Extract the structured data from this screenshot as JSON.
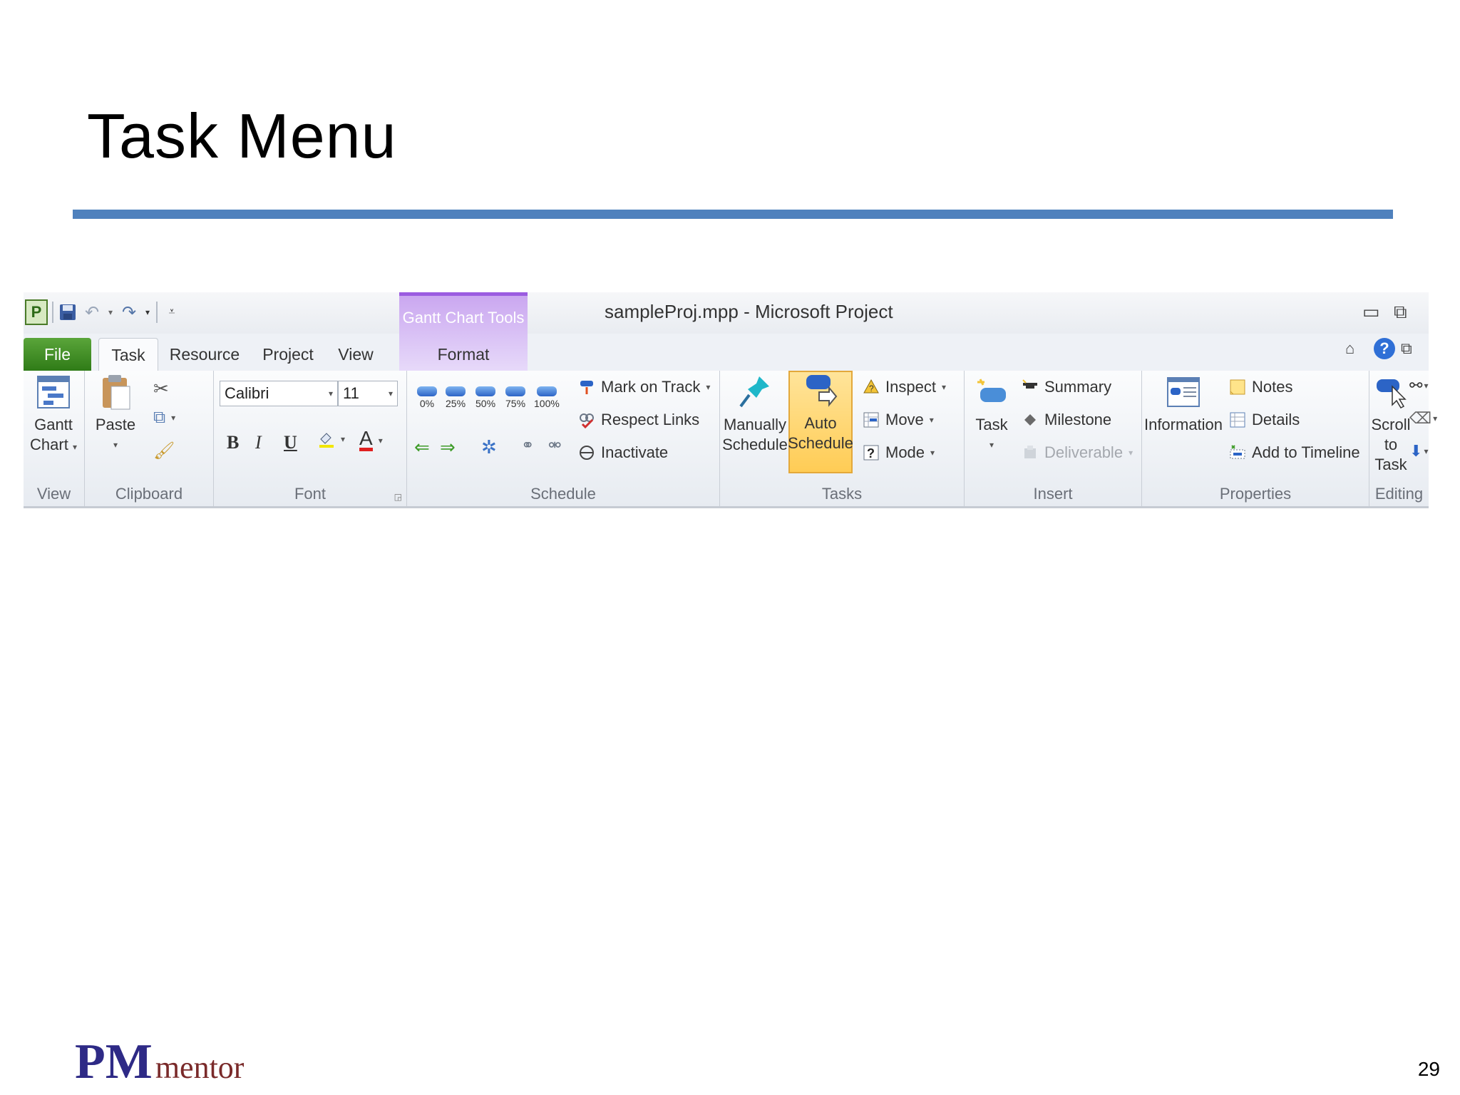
{
  "slide": {
    "title": "Task Menu",
    "page_number": "29",
    "logo": {
      "pm": "PM",
      "mentor": "mentor"
    }
  },
  "window": {
    "doc_title": "sampleProj.mpp  -  Microsoft Project",
    "contextual_tab_title": "Gantt Chart Tools"
  },
  "tabs": [
    "File",
    "Task",
    "Resource",
    "Project",
    "View",
    "Format"
  ],
  "groups": {
    "view": {
      "label": "View",
      "gantt_line1": "Gantt",
      "gantt_line2": "Chart"
    },
    "clipboard": {
      "label": "Clipboard",
      "paste": "Paste"
    },
    "font": {
      "label": "Font",
      "font_name": "Calibri",
      "font_size": "11",
      "bold": "B",
      "italic": "I",
      "underline": "U",
      "font_color": "A"
    },
    "schedule": {
      "label": "Schedule",
      "percents": [
        "0%",
        "25%",
        "50%",
        "75%",
        "100%"
      ],
      "mark_on_track": "Mark on Track",
      "respect_links": "Respect Links",
      "inactivate": "Inactivate"
    },
    "tasks": {
      "label": "Tasks",
      "manually_line1": "Manually",
      "manually_line2": "Schedule",
      "auto_line1": "Auto",
      "auto_line2": "Schedule",
      "inspect": "Inspect",
      "move": "Move",
      "mode": "Mode"
    },
    "insert": {
      "label": "Insert",
      "task": "Task",
      "summary": "Summary",
      "milestone": "Milestone",
      "deliverable": "Deliverable"
    },
    "properties": {
      "label": "Properties",
      "information": "Information",
      "notes": "Notes",
      "details": "Details",
      "add_to_timeline": "Add to Timeline"
    },
    "editing": {
      "label": "Editing",
      "scroll_line1": "Scroll",
      "scroll_line2": "to Task"
    }
  }
}
